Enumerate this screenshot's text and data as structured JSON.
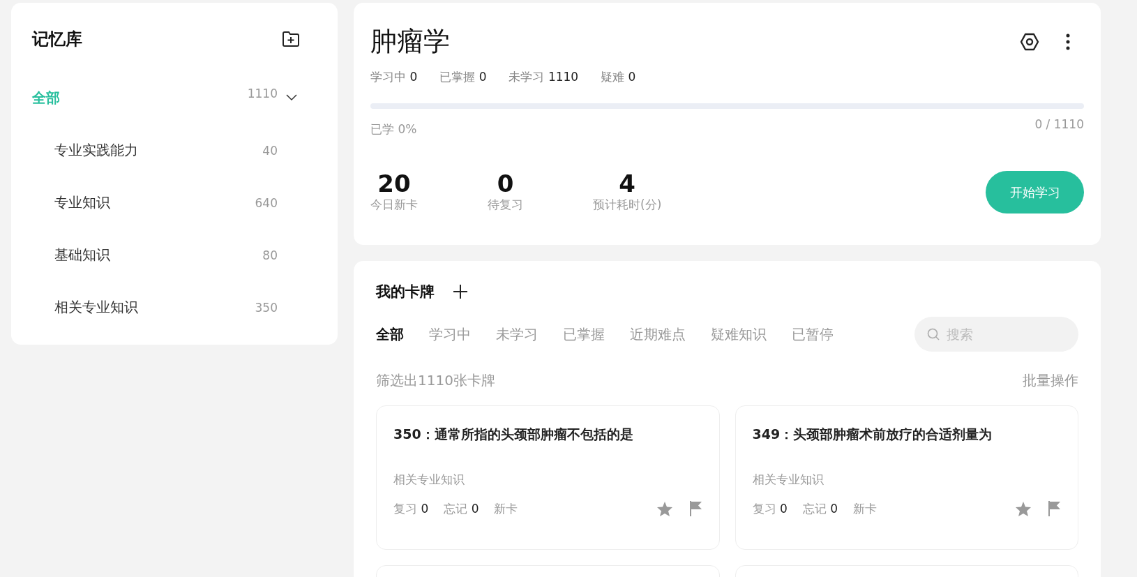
{
  "sidebar": {
    "title": "记忆库",
    "items": [
      {
        "label": "全部",
        "count": "1110",
        "selected": true,
        "expanded": true,
        "children": [
          {
            "label": "专业实践能力",
            "count": "40",
            "selected": false
          },
          {
            "label": "专业知识",
            "count": "640",
            "selected": false
          },
          {
            "label": "基础知识",
            "count": "80",
            "selected": false
          },
          {
            "label": "相关专业知识",
            "count": "350",
            "selected": false
          }
        ]
      }
    ]
  },
  "deck": {
    "title": "肿瘤学",
    "stats": [
      {
        "label": "学习中",
        "value": "0"
      },
      {
        "label": "已掌握",
        "value": "0"
      },
      {
        "label": "未学习",
        "value": "1110"
      },
      {
        "label": "疑难",
        "value": "0"
      }
    ],
    "progress": {
      "level": 0,
      "label": "已学 0%",
      "count": "0 / 1110"
    },
    "metrics": [
      {
        "value": "20",
        "label": "今日新卡"
      },
      {
        "value": "0",
        "label": "待复习"
      },
      {
        "value": "4",
        "label": "预计耗时(分)"
      }
    ],
    "start_button": "开始学习"
  },
  "cards_panel": {
    "title": "我的卡牌",
    "tabs": [
      {
        "label": "全部",
        "selected": true
      },
      {
        "label": "学习中",
        "selected": false
      },
      {
        "label": "未学习",
        "selected": false
      },
      {
        "label": "已掌握",
        "selected": false
      },
      {
        "label": "近期难点",
        "selected": false
      },
      {
        "label": "疑难知识",
        "selected": false
      },
      {
        "label": "已暂停",
        "selected": false
      }
    ],
    "search": {
      "placeholder": "搜索"
    },
    "filter_text": "筛选出1110张卡牌",
    "batch_action": "批量操作",
    "cards": [
      {
        "title": "350：通常所指的头颈部肿瘤不包括的是",
        "category": "相关专业知识",
        "review": "复习",
        "review_count": "0",
        "forget": "忘记",
        "forget_count": "0",
        "status": "新卡",
        "starred": false,
        "flagged": false
      },
      {
        "title": "349：头颈部肿瘤术前放疗的合适剂量为",
        "category": "相关专业知识",
        "review": "复习",
        "review_count": "0",
        "forget": "忘记",
        "forget_count": "0",
        "status": "新卡",
        "starred": false,
        "flagged": false
      }
    ]
  }
}
